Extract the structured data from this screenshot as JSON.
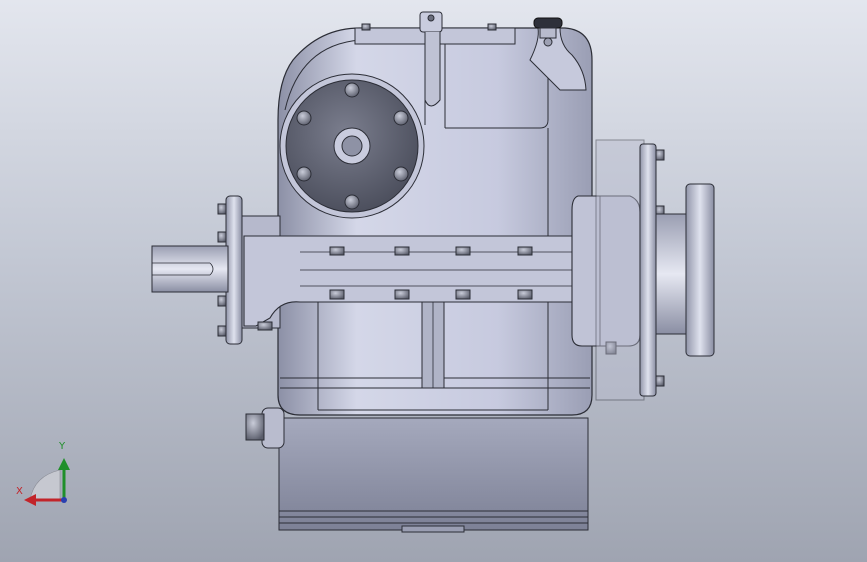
{
  "viewport": {
    "background_top": "#e3e6ee",
    "background_bottom": "#9fa4b1",
    "model": "gearbox-assembly",
    "view": "front"
  },
  "triad": {
    "x_label": "X",
    "y_label": "Y",
    "x_color": "#c2242a",
    "y_color": "#1f8f2a",
    "z_color": "#2a3fb0"
  },
  "colors": {
    "housing": "#c9cce0",
    "housing_dark": "#8e92a8",
    "flange_plate": "#5d6070",
    "bolt": "#7a7d8c",
    "edge": "#2b2d36"
  }
}
